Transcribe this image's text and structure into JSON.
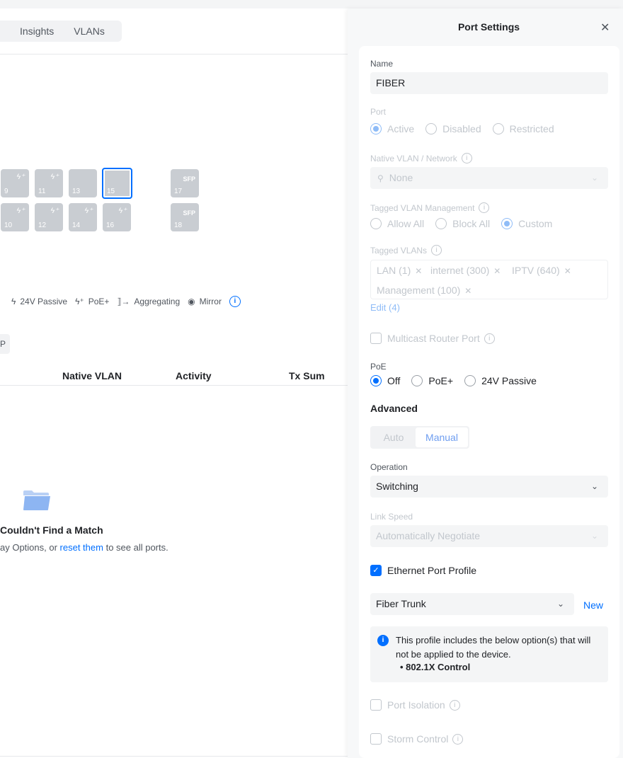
{
  "tabs": [
    {
      "label": ""
    },
    {
      "label": "Insights"
    },
    {
      "label": "VLANs"
    }
  ],
  "ports": {
    "top": [
      {
        "num": "9",
        "kind": "poe"
      },
      {
        "num": "11",
        "kind": "poe"
      },
      {
        "num": "13",
        "kind": "plain"
      },
      {
        "num": "15",
        "kind": "plain",
        "selected": true
      },
      {
        "num": "17",
        "kind": "sfp",
        "sfp_label": "SFP"
      }
    ],
    "bottom": [
      {
        "num": "10",
        "kind": "poe"
      },
      {
        "num": "12",
        "kind": "poe"
      },
      {
        "num": "14",
        "kind": "poe"
      },
      {
        "num": "16",
        "kind": "poe"
      },
      {
        "num": "18",
        "kind": "sfp",
        "sfp_label": "SFP"
      }
    ]
  },
  "legend": {
    "passive": "24V Passive",
    "poe": "PoE+",
    "aggregating": "Aggregating",
    "mirror": "Mirror"
  },
  "filter_chip": "P",
  "table": {
    "headers": [
      "Native VLAN",
      "Activity",
      "Tx Sum"
    ]
  },
  "empty": {
    "title": "Couldn't Find a Match",
    "pre": "ay Options, or ",
    "link": "reset them",
    "post": " to see all ports."
  },
  "panel": {
    "title": "Port Settings",
    "name_label": "Name",
    "name_value": "FIBER",
    "port_label": "Port",
    "port_options": [
      "Active",
      "Disabled",
      "Restricted"
    ],
    "port_selected": "Active",
    "native_vlan_label": "Native VLAN / Network",
    "native_vlan_value": "None",
    "tagged_mgmt_label": "Tagged VLAN Management",
    "tagged_mgmt_options": [
      "Allow All",
      "Block All",
      "Custom"
    ],
    "tagged_mgmt_selected": "Custom",
    "tagged_vlans_label": "Tagged VLANs",
    "tagged_vlans": [
      "LAN (1)",
      "internet (300)",
      "IPTV (640)",
      "Management (100)"
    ],
    "edit_link": "Edit (4)",
    "multicast_label": "Multicast Router Port",
    "poe_label": "PoE",
    "poe_options": [
      "Off",
      "PoE+",
      "24V Passive"
    ],
    "poe_selected": "Off",
    "advanced_label": "Advanced",
    "advanced_auto": "Auto",
    "advanced_manual": "Manual",
    "operation_label": "Operation",
    "operation_value": "Switching",
    "link_speed_label": "Link Speed",
    "link_speed_value": "Automatically Negotiate",
    "eth_profile_label": "Ethernet Port Profile",
    "eth_profile_checked": true,
    "profile_value": "Fiber Trunk",
    "new_link": "New",
    "notice_text": "This profile includes the below option(s) that will not be applied to the device.",
    "notice_item": "802.1X Control",
    "port_isolation_label": "Port Isolation",
    "storm_control_label": "Storm Control"
  },
  "colors": {
    "accent": "#006fff",
    "port_gray": "#c9cdd2",
    "panel_bg": "#f7f8f9"
  }
}
